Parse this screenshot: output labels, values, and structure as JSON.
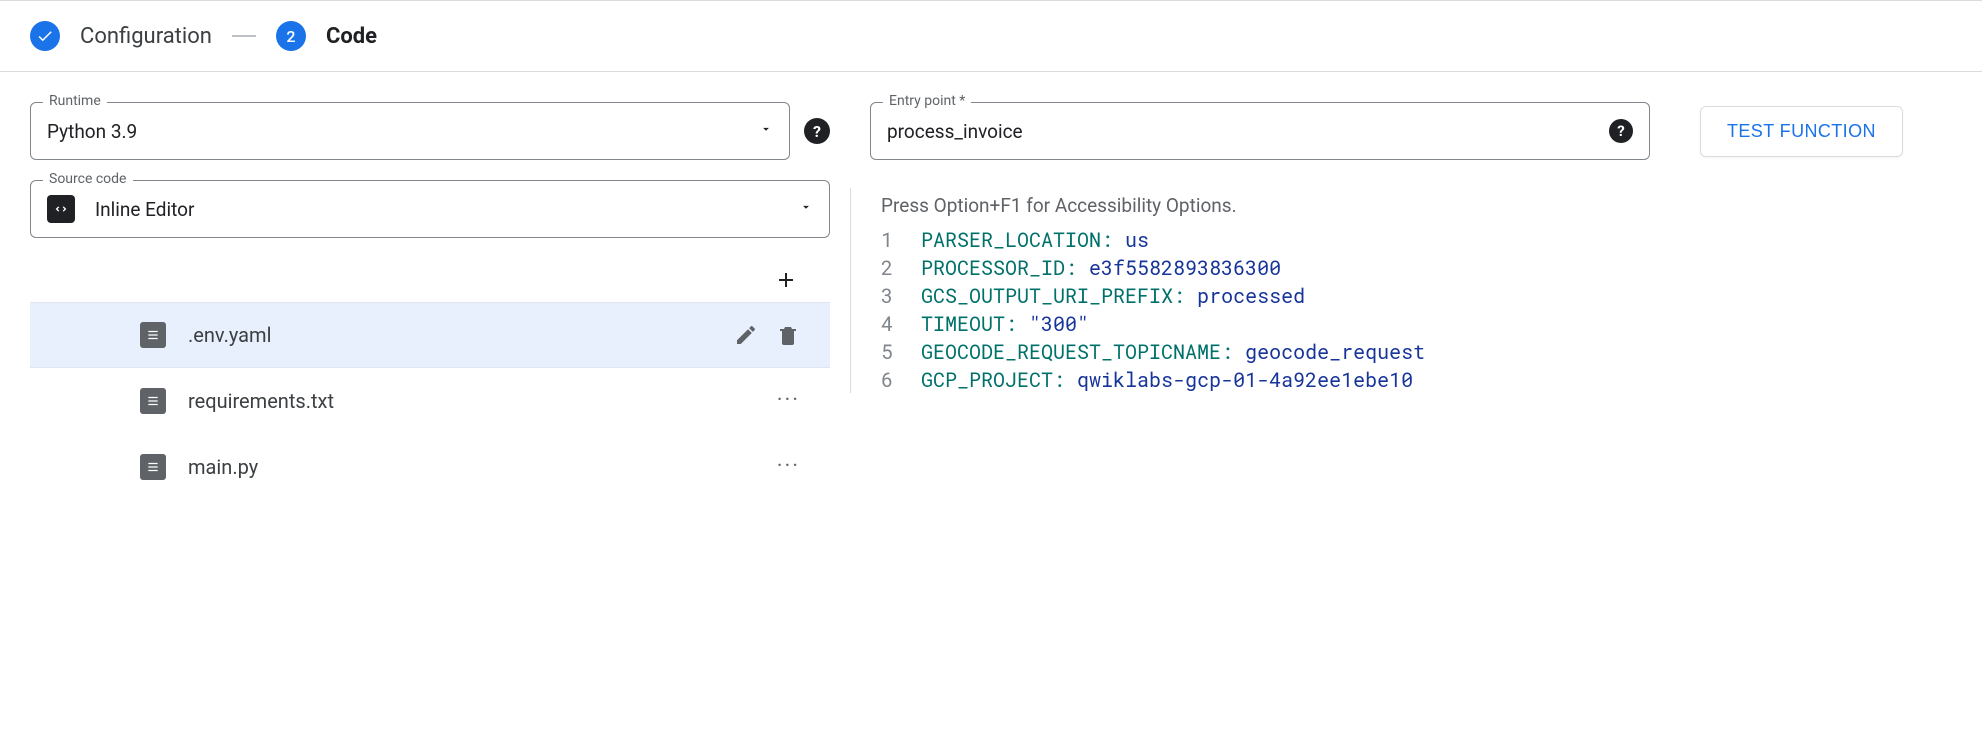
{
  "stepper": {
    "step1_label": "Configuration",
    "step2_number": "2",
    "step2_label": "Code"
  },
  "runtime_field": {
    "label": "Runtime",
    "value": "Python 3.9"
  },
  "source_field": {
    "label": "Source code",
    "value": "Inline Editor"
  },
  "entry_field": {
    "label": "Entry point *",
    "value": "process_invoice"
  },
  "test_button_label": "TEST FUNCTION",
  "files": [
    {
      "name": ".env.yaml",
      "selected": true
    },
    {
      "name": "requirements.txt",
      "selected": false
    },
    {
      "name": "main.py",
      "selected": false
    }
  ],
  "editor": {
    "a11y_hint": "Press Option+F1 for Accessibility Options.",
    "lines": [
      {
        "n": "1",
        "key": "PARSER_LOCATION",
        "val": "us"
      },
      {
        "n": "2",
        "key": "PROCESSOR_ID",
        "val": "e3f5582893836300"
      },
      {
        "n": "3",
        "key": "GCS_OUTPUT_URI_PREFIX",
        "val": "processed"
      },
      {
        "n": "4",
        "key": "TIMEOUT",
        "val": "\"300\""
      },
      {
        "n": "5",
        "key": "GEOCODE_REQUEST_TOPICNAME",
        "val": "geocode_request"
      },
      {
        "n": "6",
        "key": "GCP_PROJECT",
        "val": "qwiklabs-gcp-01-4a92ee1ebe10"
      }
    ]
  }
}
